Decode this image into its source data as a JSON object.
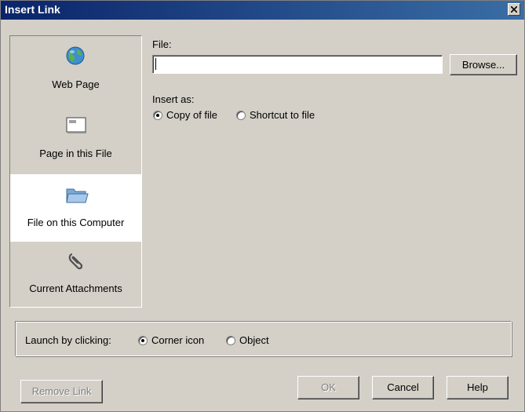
{
  "window": {
    "title": "Insert Link"
  },
  "sidebar": {
    "items": [
      {
        "label": "Web Page",
        "icon": "globe-icon",
        "selected": false
      },
      {
        "label": "Page in this File",
        "icon": "page-icon",
        "selected": false
      },
      {
        "label": "File on this Computer",
        "icon": "folder-icon",
        "selected": true
      },
      {
        "label": "Current Attachments",
        "icon": "paperclip-icon",
        "selected": false
      }
    ]
  },
  "main": {
    "file_label": "File:",
    "file_value": "",
    "browse_label": "Browse...",
    "insert_as_label": "Insert as:",
    "insert_as_options": [
      {
        "label": "Copy of file",
        "checked": true
      },
      {
        "label": "Shortcut to file",
        "checked": false
      }
    ]
  },
  "launch": {
    "label": "Launch by clicking:",
    "options": [
      {
        "label": "Corner icon",
        "checked": true
      },
      {
        "label": "Object",
        "checked": false
      }
    ]
  },
  "footer": {
    "remove_link": "Remove Link",
    "ok": "OK",
    "cancel": "Cancel",
    "help": "Help"
  }
}
